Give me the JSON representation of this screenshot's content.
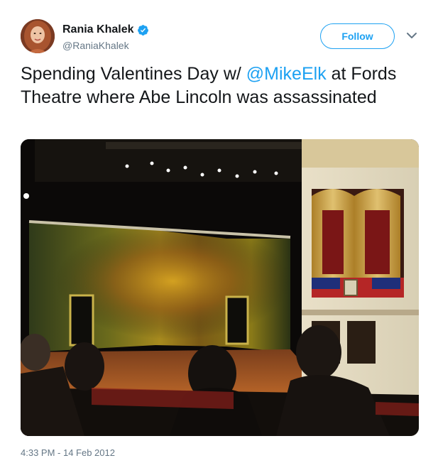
{
  "author": {
    "display_name": "Rania Khalek",
    "handle": "@RaniaKhalek",
    "verified": true,
    "avatar_icon": "profile-photo"
  },
  "actions": {
    "follow_label": "Follow",
    "more_icon": "chevron-down-icon"
  },
  "tweet": {
    "text_before": "Spending Valentines Day w/ ",
    "mention": "@MikeElk",
    "text_after": " at Fords Theatre where Abe Lincoln was assassinated",
    "timestamp": "4:33 PM - 14 Feb 2012"
  },
  "media": {
    "type": "photo",
    "subject": "theatre-stage-and-presidential-box"
  },
  "colors": {
    "accent": "#1da1f2",
    "text": "#14171a",
    "secondary_text": "#657786"
  }
}
